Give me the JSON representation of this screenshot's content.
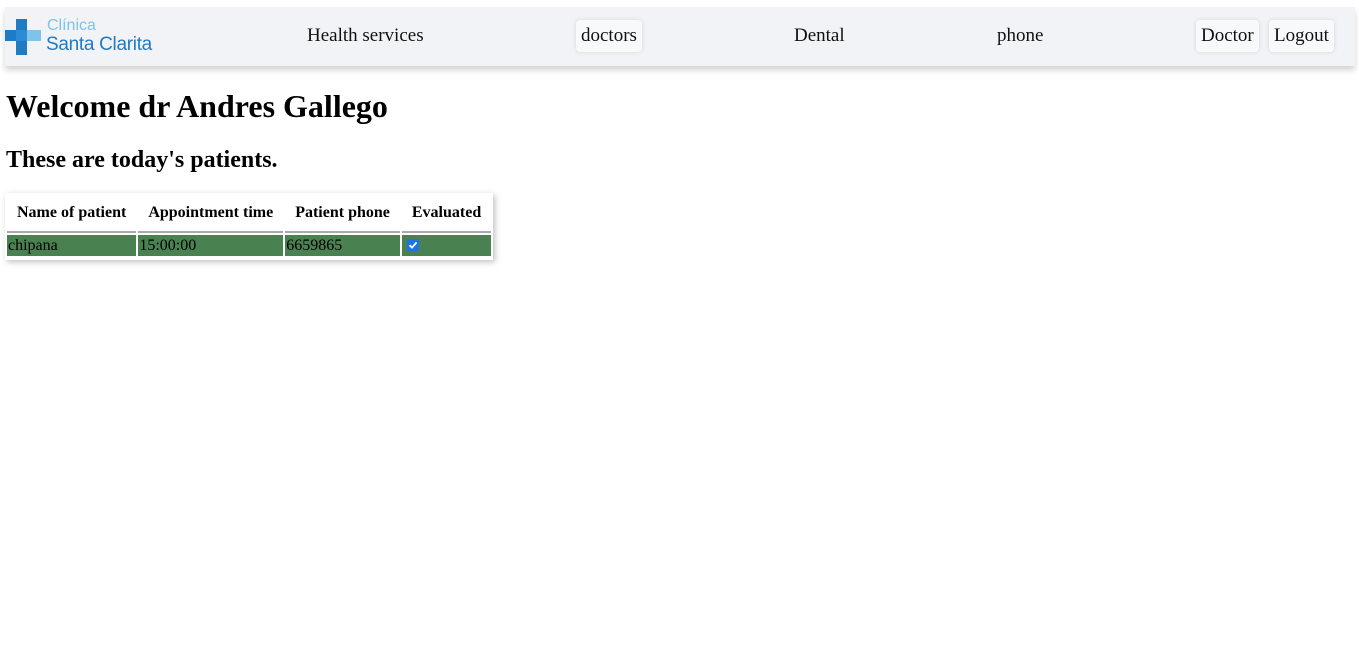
{
  "navbar": {
    "logo": {
      "line1": "Clínica",
      "line2": "Santa Clarita"
    },
    "links": [
      "Health services",
      "doctors",
      "Dental",
      "phone"
    ],
    "buttons": {
      "doctor": "Doctor",
      "logout": "Logout"
    }
  },
  "main": {
    "welcome": "Welcome dr Andres Gallego",
    "subtitle": "These are today's patients."
  },
  "table": {
    "headers": [
      "Name of patient",
      "Appointment time",
      "Patient phone",
      "Evaluated"
    ],
    "rows": [
      {
        "name": "chipana",
        "time": "15:00:00",
        "phone": "6659865",
        "evaluated": true
      }
    ]
  },
  "colors": {
    "navbar_bg": "#f2f3f7",
    "row_bg": "#4a8150",
    "logo_light": "#7ec4ea",
    "logo_dark": "#1e7bc4",
    "checkbox": "#1a73e8"
  }
}
